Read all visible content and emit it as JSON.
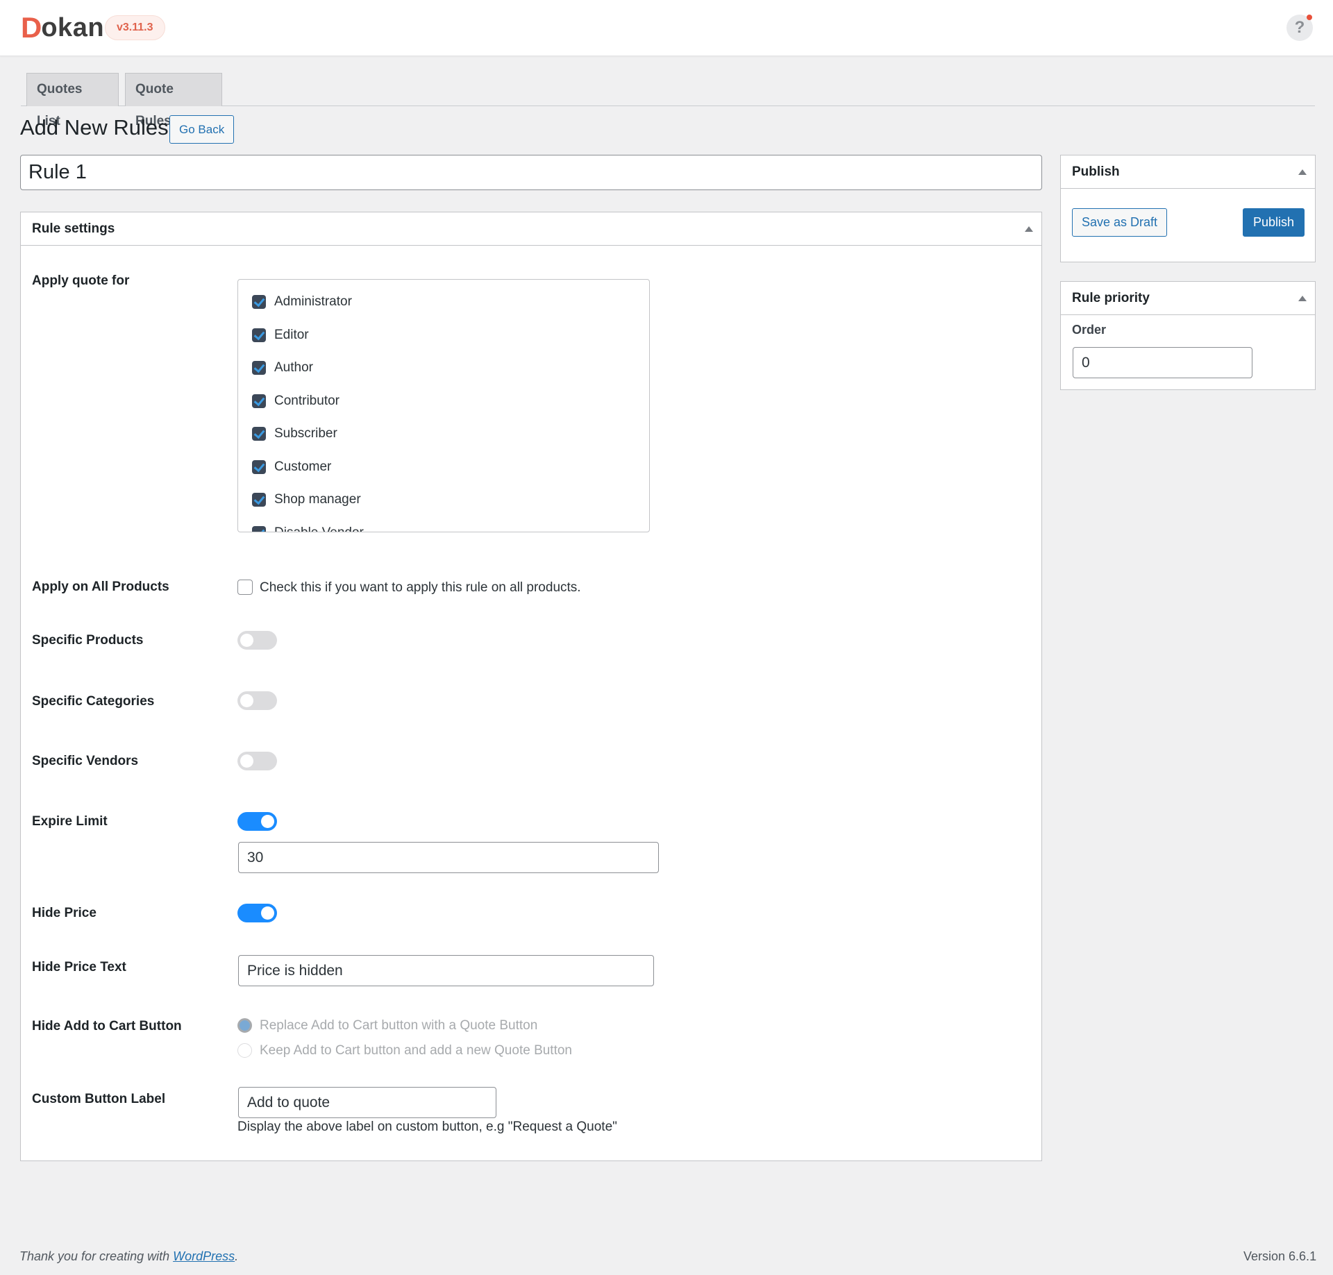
{
  "header": {
    "logo_initial": "D",
    "logo_rest": "okan",
    "version": "v3.11.3",
    "help_label": "?"
  },
  "tabs": [
    {
      "label": "Quotes List"
    },
    {
      "label": "Quote Rules"
    }
  ],
  "page": {
    "title": "Add New Rules",
    "go_back_label": "Go Back",
    "rule_title_value": "Rule 1"
  },
  "rule_settings": {
    "heading": "Rule settings",
    "apply_quote_for": {
      "label": "Apply quote for",
      "roles": [
        {
          "label": "Administrator",
          "checked": true
        },
        {
          "label": "Editor",
          "checked": true
        },
        {
          "label": "Author",
          "checked": true
        },
        {
          "label": "Contributor",
          "checked": true
        },
        {
          "label": "Subscriber",
          "checked": true
        },
        {
          "label": "Customer",
          "checked": true
        },
        {
          "label": "Shop manager",
          "checked": true
        },
        {
          "label": "Disable Vendor",
          "checked": true
        }
      ]
    },
    "apply_all_products": {
      "label": "Apply on All Products",
      "checkbox_text": "Check this if you want to apply this rule on all products.",
      "checked": false
    },
    "specific_products": {
      "label": "Specific Products",
      "enabled": false
    },
    "specific_categories": {
      "label": "Specific Categories",
      "enabled": false
    },
    "specific_vendors": {
      "label": "Specific Vendors",
      "enabled": false
    },
    "expire_limit": {
      "label": "Expire Limit",
      "enabled": true,
      "value": "30"
    },
    "hide_price": {
      "label": "Hide Price",
      "enabled": true
    },
    "hide_price_text": {
      "label": "Hide Price Text",
      "value": "Price is hidden"
    },
    "hide_add_to_cart": {
      "label": "Hide Add to Cart Button",
      "options": [
        {
          "label": "Replace Add to Cart button with a Quote Button",
          "selected": true
        },
        {
          "label": "Keep Add to Cart button and add a new Quote Button",
          "selected": false
        }
      ]
    },
    "custom_button_label": {
      "label": "Custom Button Label",
      "value": "Add to quote",
      "help": "Display the above label on custom button, e.g \"Request a Quote\""
    }
  },
  "publish": {
    "heading": "Publish",
    "save_draft_label": "Save as Draft",
    "publish_label": "Publish"
  },
  "priority": {
    "heading": "Rule priority",
    "order_label": "Order",
    "order_value": "0"
  },
  "footer": {
    "thanks_prefix": "Thank you for creating with ",
    "thanks_link": "WordPress",
    "thanks_suffix": ".",
    "version": "Version 6.6.1"
  },
  "colors": {
    "brand": "#e9604a",
    "primary": "#2271b1",
    "toggle_on": "#1a8cff"
  }
}
